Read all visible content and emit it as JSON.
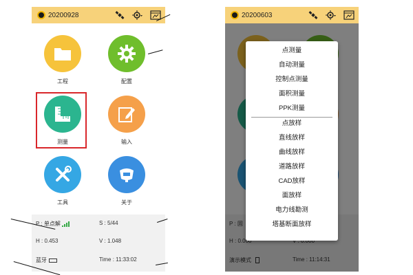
{
  "left_screen": {
    "date": "20200928",
    "tiles": [
      {
        "label": "工程",
        "color": "#f6c33b",
        "icon": "folder-icon"
      },
      {
        "label": "配置",
        "color": "#6fbe2c",
        "icon": "gear-icon"
      },
      {
        "label": "测量",
        "color": "#2bb58f",
        "icon": "ruler-icon"
      },
      {
        "label": "输入",
        "color": "#f5a04a",
        "icon": "edit-icon"
      },
      {
        "label": "工具",
        "color": "#35a7e4",
        "icon": "tools-icon"
      },
      {
        "label": "关于",
        "color": "#3a8fe0",
        "icon": "receiver-icon"
      }
    ],
    "status": {
      "p": "P : 单点解",
      "s": "S : 5/44",
      "h": "H : 0.453",
      "v": "V : 1.048",
      "bluetooth": "蓝牙",
      "time": "Time : 11:33:02"
    }
  },
  "right_screen": {
    "date": "20200603",
    "menu_items": [
      "点测量",
      "自动测量",
      "控制点测量",
      "面积测量",
      "PPK测量",
      "点放样",
      "直线放样",
      "曲线放样",
      "道路放样",
      "CAD放样",
      "面放样",
      "电力线勘测",
      "塔基断面放样"
    ],
    "status": {
      "p": "P : 固",
      "h": "H : 0.000",
      "v": "V : 0.000",
      "demo": "演示模式",
      "time": "Time : 11:14:31"
    }
  },
  "colors": {
    "topbar": "#f7d27a",
    "highlight_border": "#d9262a"
  }
}
